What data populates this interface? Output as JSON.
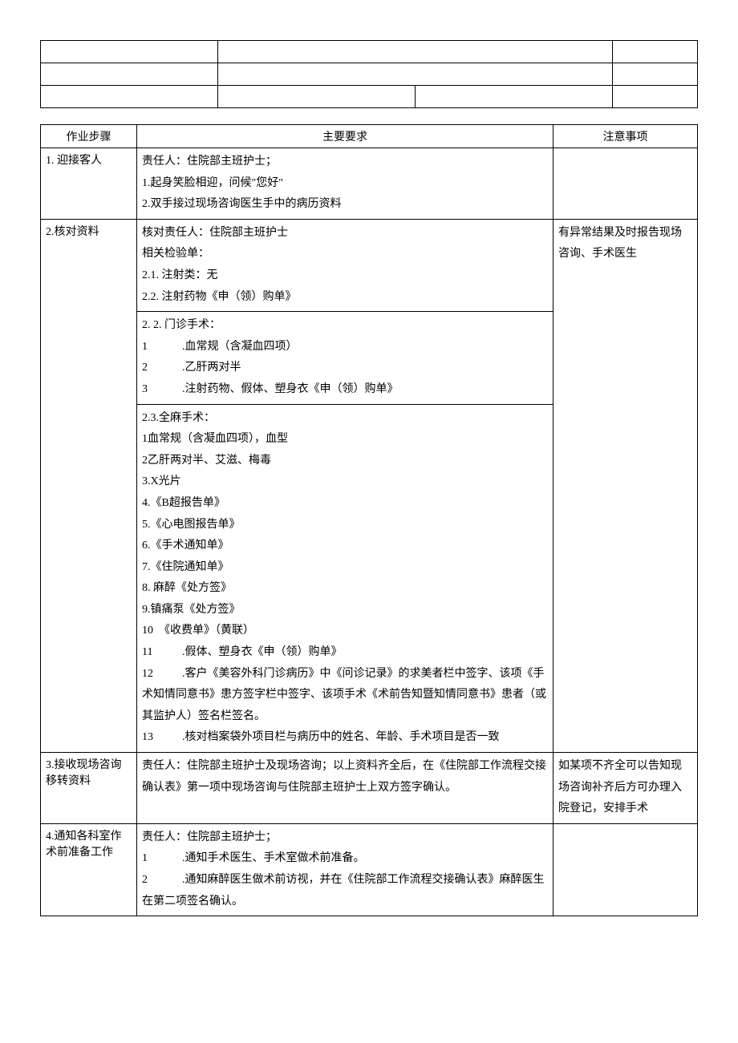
{
  "headers": {
    "col1": "作业步骤",
    "col2": "主要要求",
    "col3": "注意事项"
  },
  "row1": {
    "step": "1. 迎接客人",
    "req": {
      "line1": "责任人：住院部主班护士；",
      "line2": "1.起身笑脸相迎，问候\"您好\"",
      "line3": "2.双手接过现场咨询医生手中的病历资料"
    },
    "note": ""
  },
  "row2": {
    "step": "2.核对资料",
    "req": {
      "a1": "核对责任人：住院部主班护士",
      "a2": "相关检验单：",
      "a3": "2.1. 注射类：无",
      "a4": "2.2. 注射药物《申（领）购单》",
      "b1": "2. 2. 门诊手术：",
      "b2_n": "1",
      "b2_t": ".血常规（含凝血四项）",
      "b3_n": "2",
      "b3_t": ".乙肝两对半",
      "b4_n": "3",
      "b4_t": ".注射药物、假体、塑身衣《申（领）购单》",
      "c1": "2.3.全麻手术：",
      "c2": "1血常规（含凝血四项），血型",
      "c3": "2乙肝两对半、艾滋、梅毒",
      "c4": "3.X光片",
      "c5": "4.《B超报告单》",
      "c6": "5.《心电图报告单》",
      "c7": "6.《手术通知单》",
      "c8": "7.《住院通知单》",
      "c9": "8. 麻醉《处方签》",
      "c10": "9.镇痛泵《处方签》",
      "c11": "10　《收费单》（黄联）",
      "c12_n": "11",
      "c12_t": ".假体、塑身衣《申（领）购单》",
      "c13_n": "12",
      "c13_t": ".客户《美容外科门诊病历》中《问诊记录》的求美者栏中签字、该项《手术知情同意书》患方签字栏中签字、该项手术《术前告知暨知情同意书》患者（或其监护人）签名栏签名。",
      "c14_n": "13",
      "c14_t": ".核对档案袋外项目栏与病历中的姓名、年龄、手术项目是否一致"
    },
    "note": "有异常结果及时报告现场咨询、手术医生"
  },
  "row3": {
    "step": "3.接收现场咨询移转资料",
    "req": "责任人：住院部主班护士及现场咨询；以上资料齐全后，在《住院部工作流程交接确认表》第一项中现场咨询与住院部主班护士上双方签字确认。",
    "note": "如某项不齐全可以告知现场咨询补齐后方可办理入院登记，安排手术"
  },
  "row4": {
    "step": "4.通知各科室作术前准备工作",
    "req": {
      "line1": "责任人：住院部主班护士；",
      "line2_n": "1",
      "line2_t": ".通知手术医生、手术室做术前准备。",
      "line3_n": "2",
      "line3_t": ".通知麻醉医生做术前访视，并在《住院部工作流程交接确认表》麻醉医生在第二项签名确认。"
    },
    "note": ""
  }
}
